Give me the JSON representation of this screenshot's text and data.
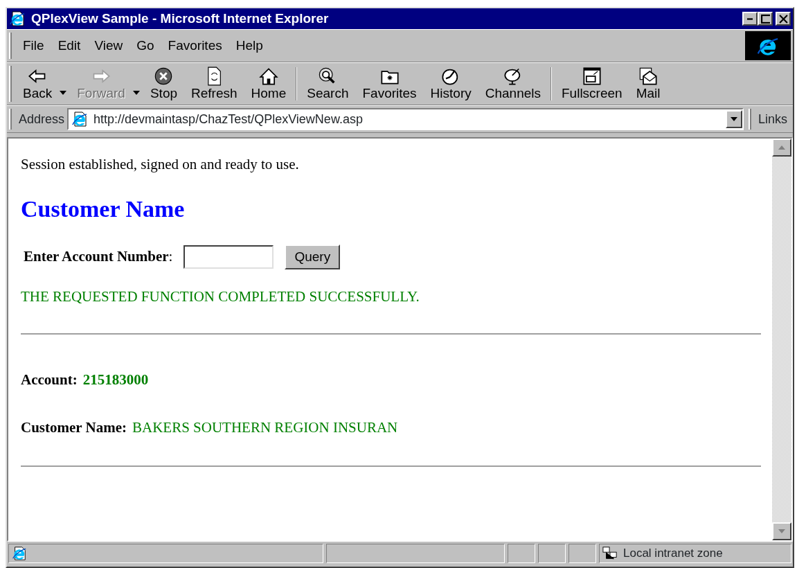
{
  "window": {
    "title": "QPlexView Sample - Microsoft Internet Explorer"
  },
  "menu": [
    {
      "label": "File"
    },
    {
      "label": "Edit"
    },
    {
      "label": "View"
    },
    {
      "label": "Go"
    },
    {
      "label": "Favorites"
    },
    {
      "label": "Help"
    }
  ],
  "toolbar": [
    [
      {
        "label": "Back",
        "disabled": false,
        "dropdown": true
      },
      {
        "label": "Forward",
        "disabled": true,
        "dropdown": true
      },
      {
        "label": "Stop",
        "disabled": false,
        "dropdown": false
      },
      {
        "label": "Refresh",
        "disabled": false,
        "dropdown": false
      },
      {
        "label": "Home",
        "disabled": false,
        "dropdown": false
      }
    ],
    [
      {
        "label": "Search",
        "disabled": false,
        "dropdown": false
      },
      {
        "label": "Favorites",
        "disabled": false,
        "dropdown": false
      },
      {
        "label": "History",
        "disabled": false,
        "dropdown": false
      },
      {
        "label": "Channels",
        "disabled": false,
        "dropdown": false
      }
    ],
    [
      {
        "label": "Fullscreen",
        "disabled": false,
        "dropdown": false
      },
      {
        "label": "Mail",
        "disabled": false,
        "dropdown": false
      }
    ]
  ],
  "address_bar": {
    "label": "Address",
    "value": "http://devmaintasp/ChazTest/QPlexViewNew.asp",
    "links": "Links"
  },
  "page": {
    "status_message": "Session established, signed on and ready to use.",
    "heading": "Customer Name",
    "form": {
      "label": "**Enter Account Number**:",
      "button": "Query"
    },
    "result_message": "THE REQUESTED FUNCTION COMPLETED SUCCESSFULLY.",
    "fields": [
      {
        "label": "Account:",
        "value": "215183000",
        "bold": true
      },
      {
        "label": "Customer Name:",
        "value": "BAKERS SOUTHERN REGION INSURAN",
        "bold": false
      }
    ]
  },
  "status_bar": {
    "zone": "Local intranet zone"
  }
}
